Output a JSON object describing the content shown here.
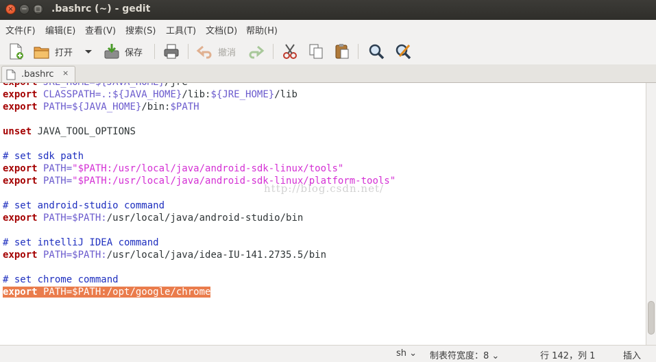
{
  "window": {
    "title": ".bashrc (~) - gedit"
  },
  "menubar": {
    "items": [
      "文件(F)",
      "编辑(E)",
      "查看(V)",
      "搜索(S)",
      "工具(T)",
      "文档(D)",
      "帮助(H)"
    ]
  },
  "toolbar": {
    "open_label": "打开",
    "save_label": "保存",
    "undo_label": "撤消"
  },
  "tabs": [
    {
      "label": ".bashrc",
      "close": "×"
    }
  ],
  "editor": {
    "lines": [
      [
        {
          "t": "export",
          "c": "kw"
        },
        {
          "t": " JRE_HOME=",
          "c": "id"
        },
        {
          "t": "${JAVA_HOME}",
          "c": "id"
        },
        {
          "t": "/jre",
          "c": ""
        }
      ],
      [
        {
          "t": "export",
          "c": "kw"
        },
        {
          "t": " CLASSPATH=.:",
          "c": "id"
        },
        {
          "t": "${JAVA_HOME}",
          "c": "id"
        },
        {
          "t": "/lib:",
          "c": ""
        },
        {
          "t": "${JRE_HOME}",
          "c": "id"
        },
        {
          "t": "/lib",
          "c": ""
        }
      ],
      [
        {
          "t": "export",
          "c": "kw"
        },
        {
          "t": " PATH=",
          "c": "id"
        },
        {
          "t": "${JAVA_HOME}",
          "c": "id"
        },
        {
          "t": "/bin:",
          "c": ""
        },
        {
          "t": "$PATH",
          "c": "id"
        }
      ],
      [],
      [
        {
          "t": "unset",
          "c": "kw"
        },
        {
          "t": " JAVA_TOOL_OPTIONS",
          "c": ""
        }
      ],
      [],
      [
        {
          "t": "# set sdk path",
          "c": "cm"
        }
      ],
      [
        {
          "t": "export",
          "c": "kw"
        },
        {
          "t": " PATH=",
          "c": "id"
        },
        {
          "t": "\"$PATH:/usr/local/java/android-sdk-linux/tools\"",
          "c": "str"
        }
      ],
      [
        {
          "t": "export",
          "c": "kw"
        },
        {
          "t": " PATH=",
          "c": "id"
        },
        {
          "t": "\"$PATH:/usr/local/java/android-sdk-linux/platform-tools\"",
          "c": "str"
        }
      ],
      [],
      [
        {
          "t": "# set android-studio command",
          "c": "cm"
        }
      ],
      [
        {
          "t": "export",
          "c": "kw"
        },
        {
          "t": " PATH=$PATH:",
          "c": "id"
        },
        {
          "t": "/usr/local/java/android-studio/bin",
          "c": ""
        }
      ],
      [],
      [
        {
          "t": "# set intelliJ IDEA command",
          "c": "cm"
        }
      ],
      [
        {
          "t": "export",
          "c": "kw"
        },
        {
          "t": " PATH=$PATH:",
          "c": "id"
        },
        {
          "t": "/usr/local/java/idea-IU-141.2735.5/bin",
          "c": ""
        }
      ],
      [],
      [
        {
          "t": "# set chrome command",
          "c": "cm"
        }
      ],
      [
        {
          "t": "export",
          "c": "kw"
        },
        {
          "t": " PATH=$PATH:/opt/google/chrome",
          "c": ""
        }
      ]
    ],
    "selected_line": 17,
    "watermark": "http://blog.csdn.net/"
  },
  "scrollbar": {
    "position_fraction": 0.96,
    "visible_fraction": 0.13
  },
  "statusbar": {
    "language": "sh",
    "tab_width": "制表符宽度：8",
    "cursor": "行 142，列 1",
    "mode": "插入"
  }
}
